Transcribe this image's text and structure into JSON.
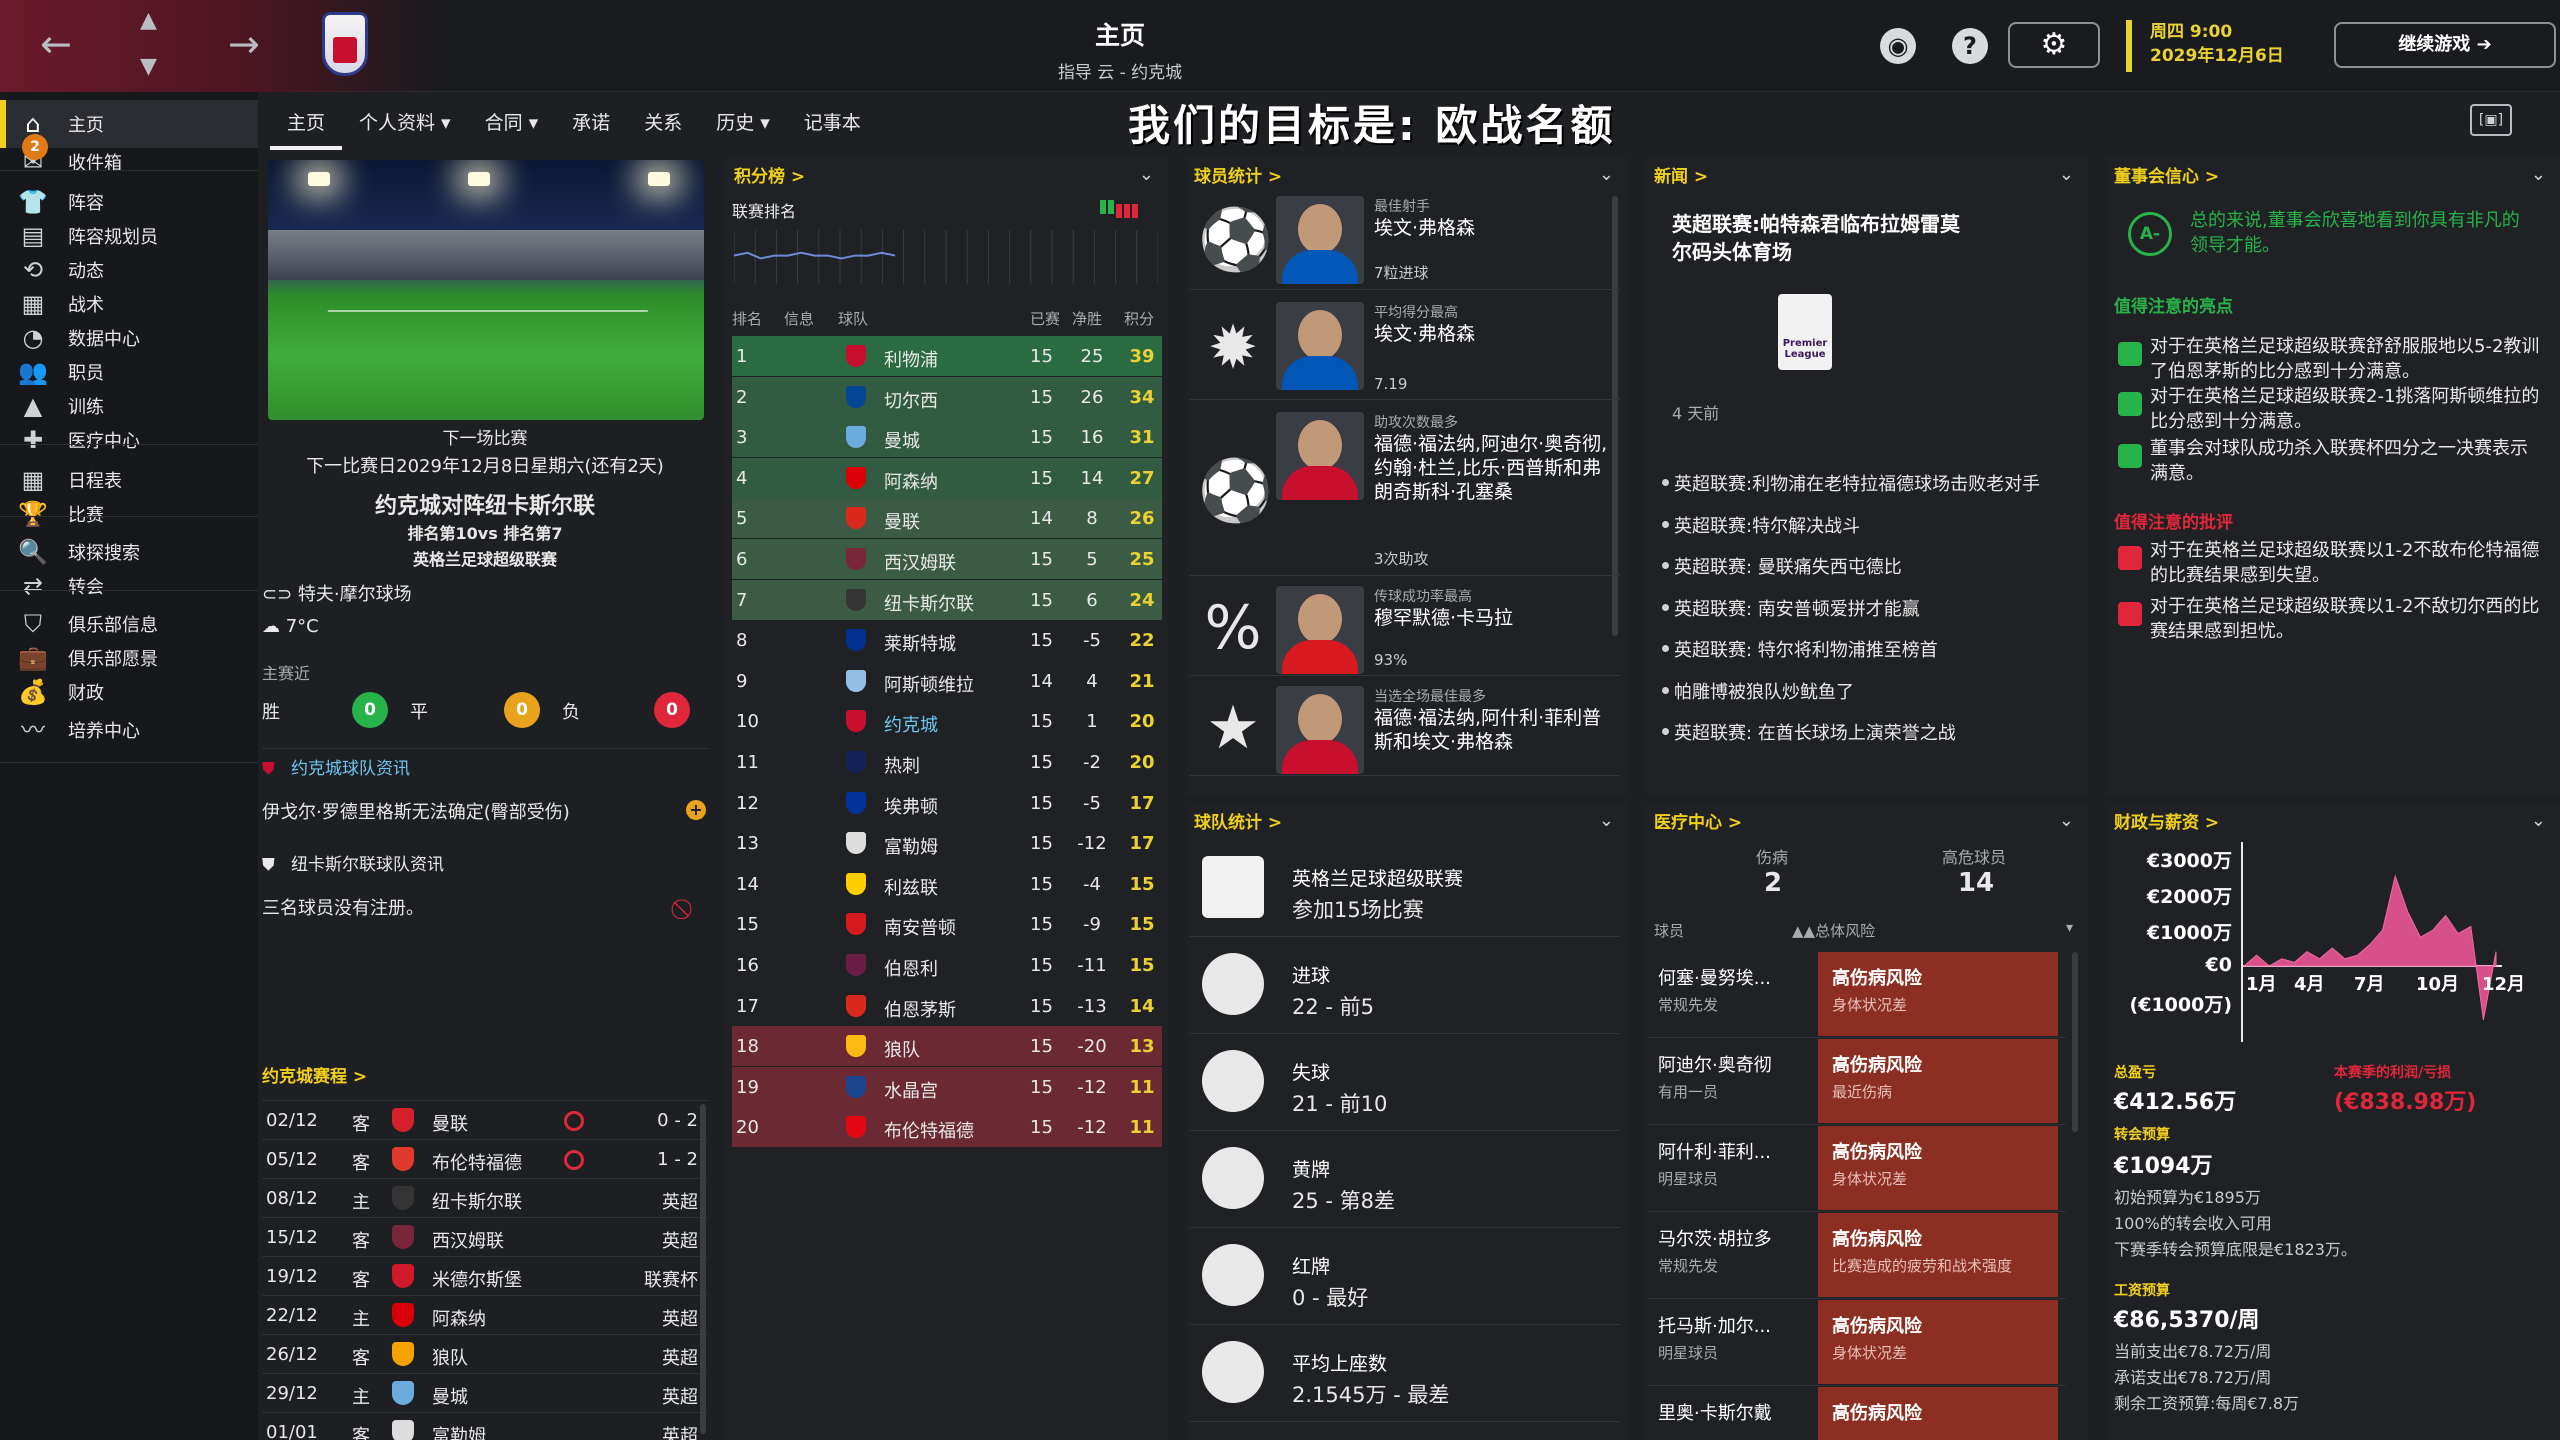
{
  "header": {
    "title": "主页",
    "subtitle": "指导 云 - 约克城",
    "day": "周四 9:00",
    "date": "2029年12月6日",
    "continue": "继续游戏",
    "help": "?"
  },
  "sidebar": [
    {
      "label": "主页",
      "icon": "home-icon",
      "glyph": "⌂"
    },
    {
      "label": "收件箱",
      "icon": "inbox-icon",
      "glyph": "✉",
      "badge": "2"
    },
    {
      "label": "阵容",
      "icon": "squad-icon",
      "glyph": "👕"
    },
    {
      "label": "阵容规划员",
      "icon": "clipboard-icon",
      "glyph": "▤"
    },
    {
      "label": "动态",
      "icon": "dynamics-icon",
      "glyph": "⟲"
    },
    {
      "label": "战术",
      "icon": "tactics-icon",
      "glyph": "▦"
    },
    {
      "label": "数据中心",
      "icon": "data-hub-icon",
      "glyph": "◔"
    },
    {
      "label": "职员",
      "icon": "staff-icon",
      "glyph": "👥"
    },
    {
      "label": "训练",
      "icon": "training-icon",
      "glyph": "▲"
    },
    {
      "label": "医疗中心",
      "icon": "medical-icon",
      "glyph": "✚"
    },
    {
      "label": "日程表",
      "icon": "calendar-icon",
      "glyph": "▦"
    },
    {
      "label": "比赛",
      "icon": "trophy-icon",
      "glyph": "🏆"
    },
    {
      "label": "球探搜索",
      "icon": "scouting-icon",
      "glyph": "🔍"
    },
    {
      "label": "转会",
      "icon": "transfers-icon",
      "glyph": "⇄"
    },
    {
      "label": "俱乐部信息",
      "icon": "shield-icon",
      "glyph": "⛉"
    },
    {
      "label": "俱乐部愿景",
      "icon": "vision-icon",
      "glyph": "💼"
    },
    {
      "label": "财政",
      "icon": "finance-icon",
      "glyph": "💰"
    },
    {
      "label": "培养中心",
      "icon": "development-icon",
      "glyph": "〰"
    }
  ],
  "tabs": [
    "主页",
    "个人资料 ▾",
    "合同 ▾",
    "承诺",
    "关系",
    "历史 ▾",
    "记事本"
  ],
  "goal": "我们的目标是: 欧战名额",
  "next_match": {
    "title": "下一场比赛",
    "date": "下一比赛日2029年12月8日星期六(还有2天)",
    "fixture": "约克城对阵纽卡斯尔联",
    "positions": "排名第10vs 排名第7",
    "competition": "英格兰足球超级联赛",
    "stadium": "特夫·摩尔球场",
    "weather": "7°C",
    "form_label": "主赛近",
    "win_label": "胜",
    "draw_label": "平",
    "loss_label": "负",
    "wins": "0",
    "draws": "0",
    "losses": "0"
  },
  "team_news": {
    "york_title": "约克城球队资讯",
    "york_item": "伊戈尔·罗德里格斯无法确定(臀部受伤)",
    "newcastle_title": "纽卡斯尔联球队资讯",
    "newcastle_item": "三名球员没有注册。"
  },
  "fixtures": {
    "title": "约克城赛程 >",
    "rows": [
      {
        "date": "02/12",
        "venue": "客",
        "opp": "曼联",
        "result": "0 - 2",
        "color": "#d4202b",
        "loss": true
      },
      {
        "date": "05/12",
        "venue": "客",
        "opp": "布伦特福德",
        "result": "1 - 2",
        "color": "#e03a2f",
        "loss": true
      },
      {
        "date": "08/12",
        "venue": "主",
        "opp": "纽卡斯尔联",
        "result": "英超",
        "color": "#333333"
      },
      {
        "date": "15/12",
        "venue": "客",
        "opp": "西汉姆联",
        "result": "英超",
        "color": "#7a263a"
      },
      {
        "date": "19/12",
        "venue": "客",
        "opp": "米德尔斯堡",
        "result": "联赛杯",
        "color": "#d0192b"
      },
      {
        "date": "22/12",
        "venue": "主",
        "opp": "阿森纳",
        "result": "英超",
        "color": "#db0007"
      },
      {
        "date": "26/12",
        "venue": "客",
        "opp": "狼队",
        "result": "英超",
        "color": "#f4a300"
      },
      {
        "date": "29/12",
        "venue": "主",
        "opp": "曼城",
        "result": "英超",
        "color": "#6cabdd"
      },
      {
        "date": "01/01",
        "venue": "客",
        "opp": "富勒姆",
        "result": "英超",
        "color": "#dddddd"
      }
    ]
  },
  "league": {
    "title": "积分榜 >",
    "subtitle": "联赛排名",
    "cols": [
      "排名",
      "信息",
      "球队",
      "已赛",
      "净胜",
      "积分"
    ],
    "form": [
      10,
      9,
      11,
      10,
      10,
      9,
      10,
      10,
      11,
      10,
      10,
      9,
      10
    ],
    "rows": [
      {
        "pos": "1",
        "club": "利物浦",
        "pl": "15",
        "gd": "25",
        "pts": "39",
        "color": "#c8102e"
      },
      {
        "pos": "2",
        "club": "切尔西",
        "pl": "15",
        "gd": "26",
        "pts": "34",
        "color": "#034694"
      },
      {
        "pos": "3",
        "club": "曼城",
        "pl": "15",
        "gd": "16",
        "pts": "31",
        "color": "#6cabdd"
      },
      {
        "pos": "4",
        "club": "阿森纳",
        "pl": "15",
        "gd": "14",
        "pts": "27",
        "color": "#db0007"
      },
      {
        "pos": "5",
        "club": "曼联",
        "pl": "14",
        "gd": "8",
        "pts": "26",
        "color": "#da291c"
      },
      {
        "pos": "6",
        "club": "西汉姆联",
        "pl": "15",
        "gd": "5",
        "pts": "25",
        "color": "#7a263a"
      },
      {
        "pos": "7",
        "club": "纽卡斯尔联",
        "pl": "15",
        "gd": "6",
        "pts": "24",
        "color": "#333333"
      },
      {
        "pos": "8",
        "club": "莱斯特城",
        "pl": "15",
        "gd": "-5",
        "pts": "22",
        "color": "#003090"
      },
      {
        "pos": "9",
        "club": "阿斯顿维拉",
        "pl": "14",
        "gd": "4",
        "pts": "21",
        "color": "#95bfe5"
      },
      {
        "pos": "10",
        "club": "约克城",
        "pl": "15",
        "gd": "1",
        "pts": "20",
        "color": "#c8102e"
      },
      {
        "pos": "11",
        "club": "热刺",
        "pl": "15",
        "gd": "-2",
        "pts": "20",
        "color": "#132257"
      },
      {
        "pos": "12",
        "club": "埃弗顿",
        "pl": "15",
        "gd": "-5",
        "pts": "17",
        "color": "#003399"
      },
      {
        "pos": "13",
        "club": "富勒姆",
        "pl": "15",
        "gd": "-12",
        "pts": "17",
        "color": "#dddddd"
      },
      {
        "pos": "14",
        "club": "利兹联",
        "pl": "15",
        "gd": "-4",
        "pts": "15",
        "color": "#ffcd00"
      },
      {
        "pos": "15",
        "club": "南安普顿",
        "pl": "15",
        "gd": "-9",
        "pts": "15",
        "color": "#d71920"
      },
      {
        "pos": "16",
        "club": "伯恩利",
        "pl": "15",
        "gd": "-11",
        "pts": "15",
        "color": "#6c1d45"
      },
      {
        "pos": "17",
        "club": "伯恩茅斯",
        "pl": "15",
        "gd": "-13",
        "pts": "14",
        "color": "#da291c"
      },
      {
        "pos": "18",
        "club": "狼队",
        "pl": "15",
        "gd": "-20",
        "pts": "13",
        "color": "#fdb913"
      },
      {
        "pos": "19",
        "club": "水晶宫",
        "pl": "15",
        "gd": "-12",
        "pts": "11",
        "color": "#1b458f"
      },
      {
        "pos": "20",
        "club": "布伦特福德",
        "pl": "15",
        "gd": "-12",
        "pts": "11",
        "color": "#e30613"
      }
    ]
  },
  "player_stats": {
    "title": "球员统计 >",
    "items": [
      {
        "cap": "最佳射手",
        "name": "埃文·弗格森",
        "sub": "7粒进球",
        "icon": "football-icon",
        "glyph": "⚽",
        "kit": "#0057b8"
      },
      {
        "cap": "平均得分最高",
        "name": "埃文·弗格森",
        "sub": "7.19",
        "icon": "rating-badge-icon",
        "glyph": "✹",
        "kit": "#0057b8"
      },
      {
        "cap": "助攻次数最多",
        "name": "福德·福法纳,阿迪尔·奥奇彻,约翰·杜兰,比乐·西普斯和弗朗奇斯科·孔塞桑",
        "sub": "3次助攻",
        "icon": "assist-icon",
        "glyph": "⚽",
        "kit": "#c8102e"
      },
      {
        "cap": "传球成功率最高",
        "name": "穆罕默德·卡马拉",
        "sub": "93%",
        "icon": "percent-icon",
        "glyph": "%",
        "kit": "#d71920"
      },
      {
        "cap": "当选全场最佳最多",
        "name": "福德·福法纳,阿什利·菲利普斯和埃文·弗格森",
        "sub": "",
        "icon": "star-icon",
        "glyph": "★",
        "kit": "#c8102e"
      }
    ]
  },
  "team_stats": {
    "title": "球队统计 >",
    "items": [
      {
        "l1": "英格兰足球超级联赛",
        "l2": "参加15场比赛",
        "icon": "premier-league-icon"
      },
      {
        "l1": "进球",
        "l2": "22 - 前5",
        "icon": "goals-icon"
      },
      {
        "l1": "失球",
        "l2": "21 - 前10",
        "icon": "conceded-icon"
      },
      {
        "l1": "黄牌",
        "l2": "25 - 第8差",
        "icon": "yellow-card-icon"
      },
      {
        "l1": "红牌",
        "l2": "0 - 最好",
        "icon": "red-card-icon"
      },
      {
        "l1": "平均上座数",
        "l2": "2.1545万 - 最差",
        "icon": "attendance-icon"
      }
    ]
  },
  "news": {
    "title": "新闻 >",
    "headline": "英超联赛:帕特森君临布拉姆雷莫尔码头体育场",
    "ago": "4 天前",
    "items": [
      "英超联赛:利物浦在老特拉福德球场击败老对手",
      "英超联赛:特尔解决战斗",
      "英超联赛: 曼联痛失西屯德比",
      "英超联赛: 南安普顿爱拼才能赢",
      "英超联赛: 特尔将利物浦推至榜首",
      "帕雕博被狼队炒鱿鱼了",
      "英超联赛: 在酋长球场上演荣誉之战"
    ]
  },
  "medical": {
    "title": "医疗中心 >",
    "injured_label": "伤病",
    "injured": "2",
    "high_risk_label": "高危球员",
    "high_risk": "14",
    "col_player": "球员",
    "col_risk": "▲▲总体风险",
    "rows": [
      {
        "name": "何塞·曼努埃...",
        "role": "常规先发",
        "risk": "高伤病风险",
        "reason": "身体状况差"
      },
      {
        "name": "阿迪尔·奥奇彻",
        "role": "有用一员",
        "risk": "高伤病风险",
        "reason": "最近伤病"
      },
      {
        "name": "阿什利·菲利...",
        "role": "明星球员",
        "risk": "高伤病风险",
        "reason": "身体状况差"
      },
      {
        "name": "马尔茨·胡拉多",
        "role": "常规先发",
        "risk": "高伤病风险",
        "reason": "比赛造成的疲劳和战术强度"
      },
      {
        "name": "托马斯·加尔...",
        "role": "明星球员",
        "risk": "高伤病风险",
        "reason": "身体状况差"
      },
      {
        "name": "里奥·卡斯尔戴",
        "role": "",
        "risk": "高伤病风险",
        "reason": ""
      }
    ]
  },
  "board": {
    "title": "董事会信心 >",
    "grade": "A-",
    "summary": "总的来说,董事会欣喜地看到你具有非凡的领导才能。",
    "highlights_title": "值得注意的亮点",
    "highlights": [
      "对于在英格兰足球超级联赛舒舒服服地以5-2教训了伯恩茅斯的比分感到十分满意。",
      "对于在英格兰足球超级联赛2-1挑落阿斯顿维拉的比分感到十分满意。",
      "董事会对球队成功杀入联赛杯四分之一决赛表示满意。"
    ],
    "critic_title": "值得注意的批评",
    "critics": [
      "对于在英格兰足球超级联赛以1-2不敌布伦特福德的比赛结果感到失望。",
      "对于在英格兰足球超级联赛以1-2不敌切尔西的比赛结果感到担忧。"
    ]
  },
  "finance": {
    "title": "财政与薪资 >",
    "y_ticks": [
      "€3000万",
      "€2000万",
      "€1000万",
      "€0",
      "(€1000万)"
    ],
    "x_ticks": [
      "1月",
      "4月",
      "7月",
      "10月",
      "12月"
    ],
    "series": [
      0,
      0.3,
      0,
      0.2,
      0.1,
      0.4,
      0.2,
      0.5,
      0.2,
      0.3,
      0.6,
      1.0,
      2.5,
      1.5,
      0.8,
      1.0,
      1.4,
      0.9,
      1.1,
      -1.5,
      0.4
    ],
    "balance_label": "总盈亏",
    "balance": "€412.56万",
    "profit_label": "本赛季的利润/亏损",
    "profit": "(€838.98万)",
    "transfer_label": "转会预算",
    "transfer": "€1094万",
    "transfer_l1": "初始预算为€1895万",
    "transfer_l2": "100%的转会收入可用",
    "transfer_l3": "下赛季转会预算底限是€1823万。",
    "wage_label": "工资预算",
    "wage": "€86,5370/周",
    "wage_l1": "当前支出€78.72万/周",
    "wage_l2": "承诺支出€78.72万/周",
    "wage_l3": "剩余工资预算:每周€7.8万"
  }
}
